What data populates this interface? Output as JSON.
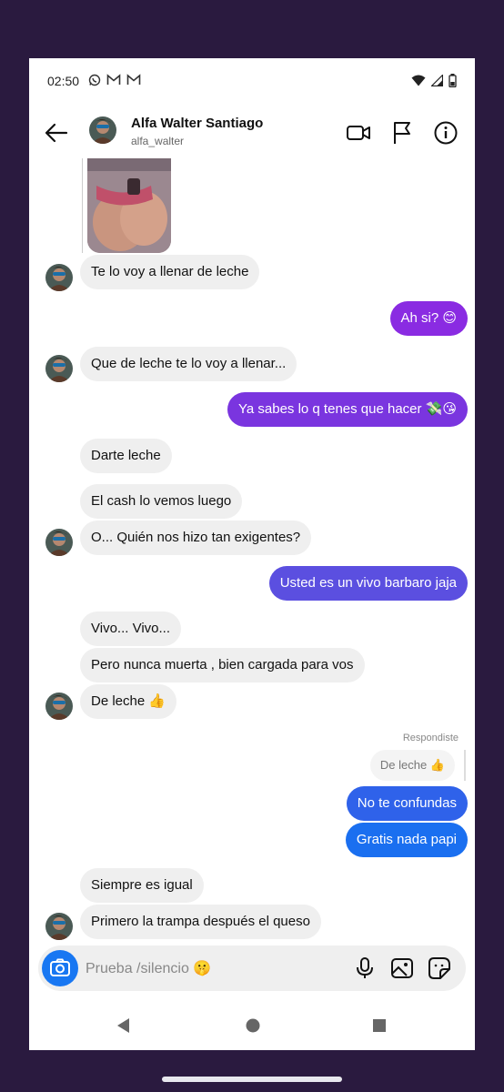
{
  "status": {
    "time": "02:50",
    "icons": [
      "whatsapp-icon",
      "gmail-icon",
      "gmail-icon",
      "wifi-icon",
      "signal-icon",
      "battery-icon"
    ]
  },
  "header": {
    "name": "Alfa Walter Santiago",
    "username": "alfa_walter",
    "icons": [
      "back-arrow-icon",
      "video-call-icon",
      "flag-icon",
      "info-icon"
    ]
  },
  "messages": [
    {
      "side": "received",
      "text": "Te lo voy a llenar de leche"
    },
    {
      "side": "sent",
      "text": "Ah si? 😊"
    },
    {
      "side": "received",
      "text": "Que de leche te lo voy a llenar..."
    },
    {
      "side": "sent",
      "text": "Ya sabes lo q tenes que hacer 💸😘"
    },
    {
      "side": "received",
      "text": "Darte leche"
    },
    {
      "side": "received",
      "text": "El cash lo vemos luego"
    },
    {
      "side": "received",
      "text": "O... Quién nos hizo tan exigentes?"
    },
    {
      "side": "sent",
      "text": "Usted es un vivo barbaro jaja"
    },
    {
      "side": "received",
      "text": "Vivo... Vivo..."
    },
    {
      "side": "received",
      "text": "Pero nunca muerta , bien cargada para vos"
    },
    {
      "side": "received",
      "text": "De leche 👍"
    },
    {
      "side": "sent",
      "text": "No te confundas"
    },
    {
      "side": "sent",
      "text": "Gratis nada papi"
    },
    {
      "side": "received",
      "text": "Siempre es igual"
    },
    {
      "side": "received",
      "text": "Primero la trampa después el queso"
    }
  ],
  "reply": {
    "label": "Respondiste",
    "quote": "De leche 👍"
  },
  "composer": {
    "placeholder": "Prueba /silencio 🤫",
    "icons": [
      "camera-icon",
      "microphone-icon",
      "gallery-icon",
      "sticker-icon"
    ]
  },
  "navbar": {
    "icons": [
      "nav-back-icon",
      "nav-home-icon",
      "nav-recents-icon"
    ]
  },
  "colors": {
    "sent_top": "#8a2be2",
    "sent_mid": "#5b4fe0",
    "sent_bottom": "#1a6ff0",
    "received_bg": "#efefef"
  }
}
